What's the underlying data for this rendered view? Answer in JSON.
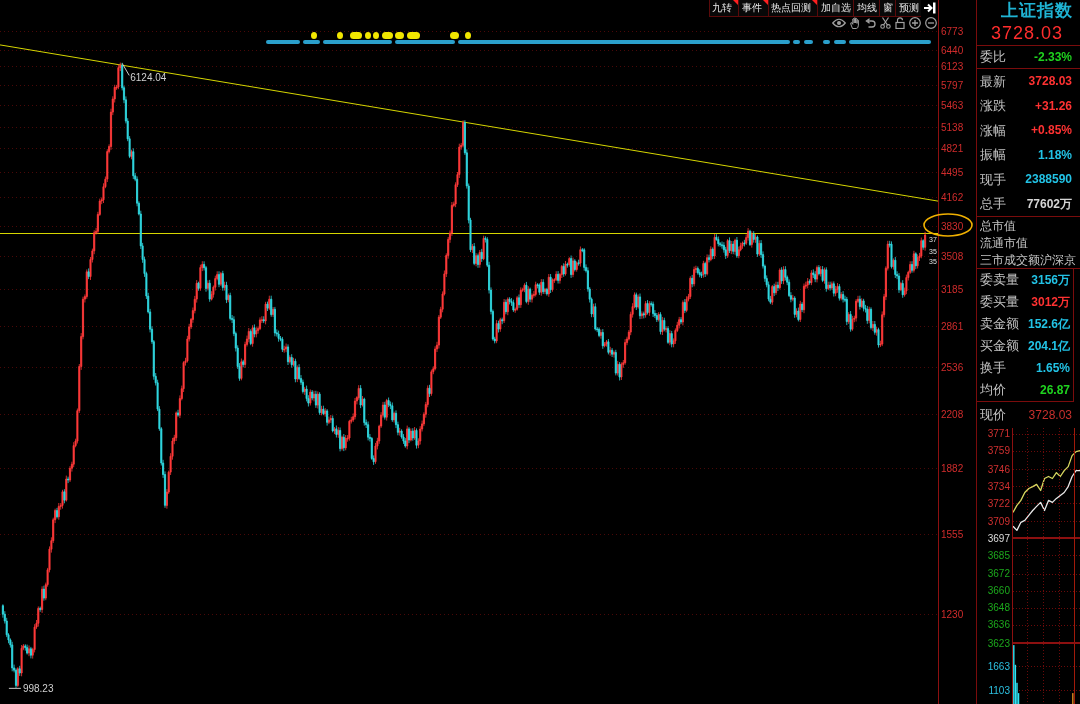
{
  "toolbar": {
    "tabs": [
      {
        "label": "九转",
        "flagged": true
      },
      {
        "label": "事件",
        "flagged": true
      },
      {
        "label": "热点回测",
        "flagged": true
      },
      {
        "label": "加自选",
        "flagged": false
      },
      {
        "label": "均线",
        "flagged": false
      },
      {
        "label": "窗",
        "flagged": false
      },
      {
        "label": "预测",
        "flagged": false
      }
    ]
  },
  "main_chart": {
    "axis_labels": [
      "6773",
      "6440",
      "6123",
      "5797",
      "5463",
      "5138",
      "4821",
      "4495",
      "4162",
      "3830",
      "3508",
      "3185",
      "2861",
      "2536",
      "2208",
      "1882",
      "1555",
      "1230"
    ],
    "high_label": "6124.04",
    "low_label": "998.23",
    "end_tags": [
      "37",
      "35",
      "35"
    ]
  },
  "quote_panel": {
    "title": "上证指数",
    "price": "3728.03",
    "ratio": {
      "label": "委比",
      "value": "-2.33%",
      "color": "#1fd21f"
    },
    "stats": [
      {
        "label": "最新",
        "value": "3728.03",
        "color": "#ff3232"
      },
      {
        "label": "涨跌",
        "value": "+31.26",
        "color": "#ff3232"
      },
      {
        "label": "涨幅",
        "value": "+0.85%",
        "color": "#ff3232"
      },
      {
        "label": "振幅",
        "value": "1.18%",
        "color": "#22c3e6"
      },
      {
        "label": "现手",
        "value": "2388590",
        "color": "#22c3e6"
      },
      {
        "label": "总手",
        "value": "77602万",
        "color": "#d6d6d6"
      }
    ],
    "market": [
      "总市值",
      "流通市值",
      "三市成交额沪深京"
    ],
    "orders": [
      {
        "label": "委卖量",
        "value": "3156万",
        "color": "#22c3e6"
      },
      {
        "label": "委买量",
        "value": "3012万",
        "color": "#ff3232"
      },
      {
        "label": "卖金额",
        "value": "152.6亿",
        "color": "#22c3e6"
      },
      {
        "label": "买金额",
        "value": "204.1亿",
        "color": "#22c3e6"
      },
      {
        "label": "换手",
        "value": "1.65%",
        "color": "#22c3e6"
      },
      {
        "label": "均价",
        "value": "26.87",
        "color": "#1fd21f"
      }
    ],
    "current": {
      "label": "现价",
      "value": "3728.03",
      "color": "#c8302c"
    }
  },
  "intraday_chart": {
    "chart_data": {
      "type": "line",
      "ylim": [
        3623,
        3775
      ],
      "grid": true,
      "yticks": [
        3623,
        3636,
        3648,
        3660,
        3672,
        3685,
        3697,
        3709,
        3722,
        3734,
        3746,
        3759,
        3771
      ],
      "series": [
        {
          "color": "#e8e8e8",
          "values": [
            3705.5,
            3702.6,
            3708.3,
            3709.7,
            3713.2,
            3716.7,
            3719.6,
            3722.4,
            3716.7,
            3723.8,
            3722.4,
            3725.2,
            3727.3,
            3729.4,
            3733.6,
            3740.7,
            3744.9,
            3744.9
          ]
        },
        {
          "color": "#d8d860",
          "values": [
            3715.3,
            3720.3,
            3723.8,
            3729.4,
            3732.2,
            3733.6,
            3735.1,
            3730.8,
            3739.3,
            3740.7,
            3739.3,
            3743.5,
            3740.7,
            3744.9,
            3747.7,
            3755.5,
            3758.3,
            3759
          ]
        }
      ],
      "ref_lines": [
        {
          "axis": "y",
          "value": 3697
        }
      ]
    }
  },
  "volume_chart": {
    "chart_data": {
      "type": "bar",
      "ylim": [
        776,
        2200
      ],
      "grid": true,
      "yticks": [
        1103,
        1663
      ],
      "series": [
        {
          "color": "#30e4f4",
          "values": [
            2150,
            1690,
            1270,
            1030,
            null,
            null,
            null,
            null,
            null,
            null,
            null,
            null,
            null,
            null,
            null,
            null,
            null,
            null,
            null,
            null,
            null,
            null,
            null,
            null,
            null,
            null,
            null,
            null,
            null,
            null,
            null,
            null,
            null,
            null,
            null,
            null,
            null,
            null,
            null,
            null,
            null,
            null
          ]
        },
        {
          "color": "#e08a20",
          "values": [
            null,
            null,
            null,
            null,
            null,
            null,
            null,
            null,
            null,
            null,
            null,
            null,
            null,
            null,
            null,
            null,
            null,
            null,
            null,
            null,
            null,
            null,
            null,
            null,
            null,
            null,
            null,
            null,
            null,
            null,
            null,
            null,
            null,
            null,
            null,
            null,
            null,
            1030,
            null,
            null,
            null,
            null
          ]
        }
      ]
    }
  }
}
